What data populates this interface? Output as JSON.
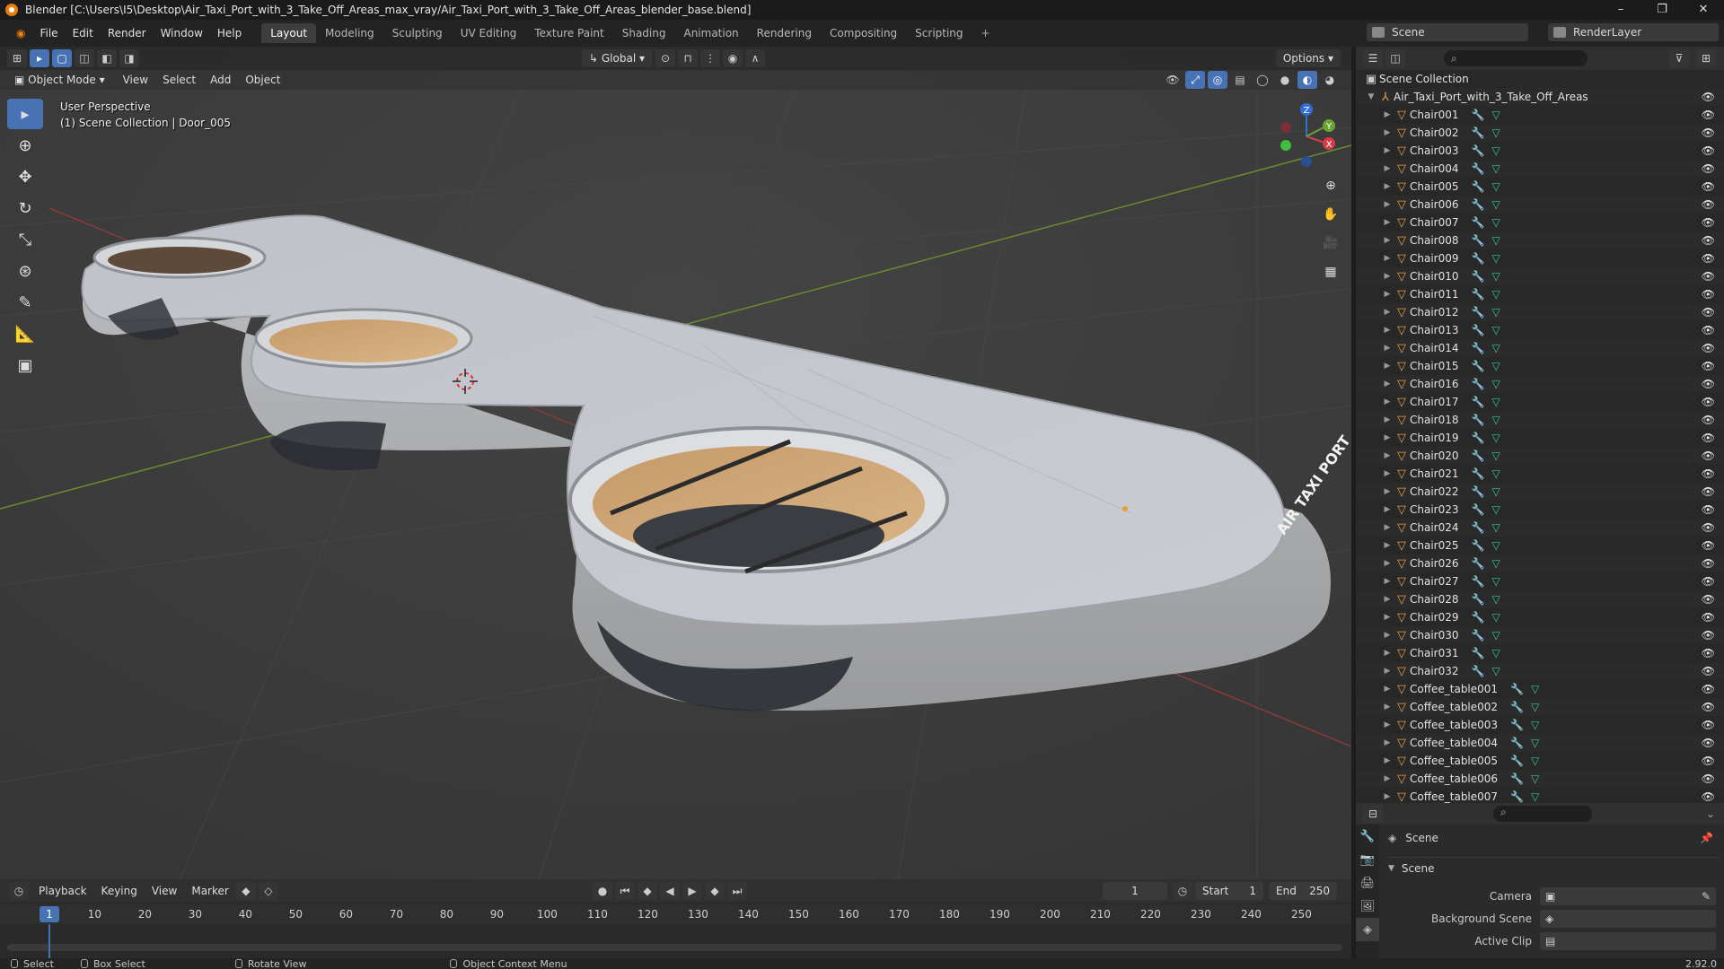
{
  "window": {
    "title": "Blender [C:\\Users\\I5\\Desktop\\Air_Taxi_Port_with_3_Take_Off_Areas_max_vray/Air_Taxi_Port_with_3_Take_Off_Areas_blender_base.blend]",
    "controls": [
      "–",
      "❐",
      "✕"
    ]
  },
  "menus": [
    "File",
    "Edit",
    "Render",
    "Window",
    "Help"
  ],
  "workspaces": [
    "Layout",
    "Modeling",
    "Sculpting",
    "UV Editing",
    "Texture Paint",
    "Shading",
    "Animation",
    "Rendering",
    "Compositing",
    "Scripting",
    "+"
  ],
  "active_workspace": "Layout",
  "scene_name": "Scene",
  "view_layer": "RenderLayer",
  "viewport": {
    "mode": "Object Mode",
    "menus": [
      "View",
      "Select",
      "Add",
      "Object"
    ],
    "transform": "Global",
    "options": "Options",
    "perspective": "User Perspective",
    "collection_info": "(1) Scene Collection | Door_005",
    "gizmo": {
      "x": "X",
      "y": "Y",
      "z": "Z"
    },
    "sign_text": "AIR TAXI PORT"
  },
  "outliner": {
    "root": "Scene Collection",
    "collection": "Air_Taxi_Port_with_3_Take_Off_Areas",
    "objects": [
      "Chair001",
      "Chair002",
      "Chair003",
      "Chair004",
      "Chair005",
      "Chair006",
      "Chair007",
      "Chair008",
      "Chair009",
      "Chair010",
      "Chair011",
      "Chair012",
      "Chair013",
      "Chair014",
      "Chair015",
      "Chair016",
      "Chair017",
      "Chair018",
      "Chair019",
      "Chair020",
      "Chair021",
      "Chair022",
      "Chair023",
      "Chair024",
      "Chair025",
      "Chair026",
      "Chair027",
      "Chair028",
      "Chair029",
      "Chair030",
      "Chair031",
      "Chair032",
      "Coffee_table001",
      "Coffee_table002",
      "Coffee_table003",
      "Coffee_table004",
      "Coffee_table005",
      "Coffee_table006",
      "Coffee_table007"
    ]
  },
  "properties": {
    "context": "Scene",
    "panel": "Scene",
    "fields": [
      {
        "label": "Camera"
      },
      {
        "label": "Background Scene"
      },
      {
        "label": "Active Clip"
      }
    ]
  },
  "timeline": {
    "menus": [
      "Playback",
      "Keying",
      "View",
      "Marker"
    ],
    "current_frame": "1",
    "start_label": "Start",
    "start": "1",
    "end_label": "End",
    "end": "250",
    "ticks": [
      "10",
      "20",
      "30",
      "40",
      "50",
      "60",
      "70",
      "80",
      "90",
      "100",
      "110",
      "120",
      "130",
      "140",
      "150",
      "160",
      "170",
      "180",
      "190",
      "200",
      "210",
      "220",
      "230",
      "240",
      "250"
    ],
    "marker_label": "1"
  },
  "statusbar": {
    "items": [
      "Select",
      "Box Select",
      "Rotate View",
      "Object Context Menu"
    ],
    "version": "2.92.0"
  },
  "colors": {
    "accent": "#4772b3",
    "object_icon": "#e89a4a",
    "mesh_icon": "#38c79c",
    "modifier_icon": "#6d9ed8"
  }
}
